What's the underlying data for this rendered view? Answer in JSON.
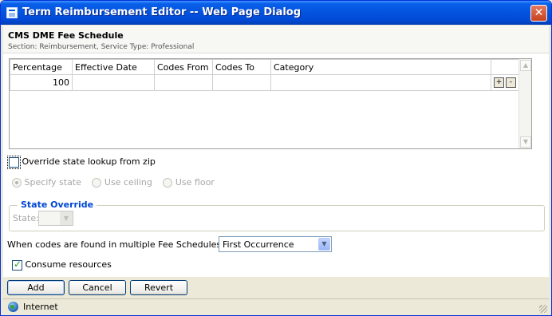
{
  "window": {
    "title": "Term Reimbursement Editor -- Web Page Dialog",
    "close_glyph": "✕"
  },
  "header": {
    "title": "CMS DME Fee Schedule",
    "subtitle": "Section: Reimbursement, Service Type: Professional"
  },
  "grid": {
    "columns": [
      "Percentage",
      "Effective Date",
      "Codes From",
      "Codes To",
      "Category"
    ],
    "rows": [
      {
        "percentage": "100",
        "effective_date": "",
        "codes_from": "",
        "codes_to": "",
        "category": ""
      }
    ],
    "add_glyph": "+",
    "remove_glyph": "-"
  },
  "override": {
    "label": "Override state lookup from zip",
    "checked": false
  },
  "radios": {
    "specify_state": "Specify state",
    "use_ceiling": "Use ceiling",
    "use_floor": "Use floor",
    "selected": "specify_state"
  },
  "state_override": {
    "legend": "State Override",
    "state_label": "State:",
    "state_value": ""
  },
  "pay": {
    "label": "When codes are found in multiple Fee Schedules, pay:",
    "selected": "First Occurrence"
  },
  "consume": {
    "label": "Consume resources",
    "checked": true
  },
  "buttons": {
    "add": "Add",
    "cancel": "Cancel",
    "revert": "Revert"
  },
  "status": {
    "zone": "Internet"
  },
  "colors": {
    "titlebar": "#0353df",
    "legend": "#0046d5",
    "check": "#21a121"
  },
  "icons": {
    "title": "dialog-icon",
    "close": "close-icon",
    "zone": "globe-icon"
  }
}
